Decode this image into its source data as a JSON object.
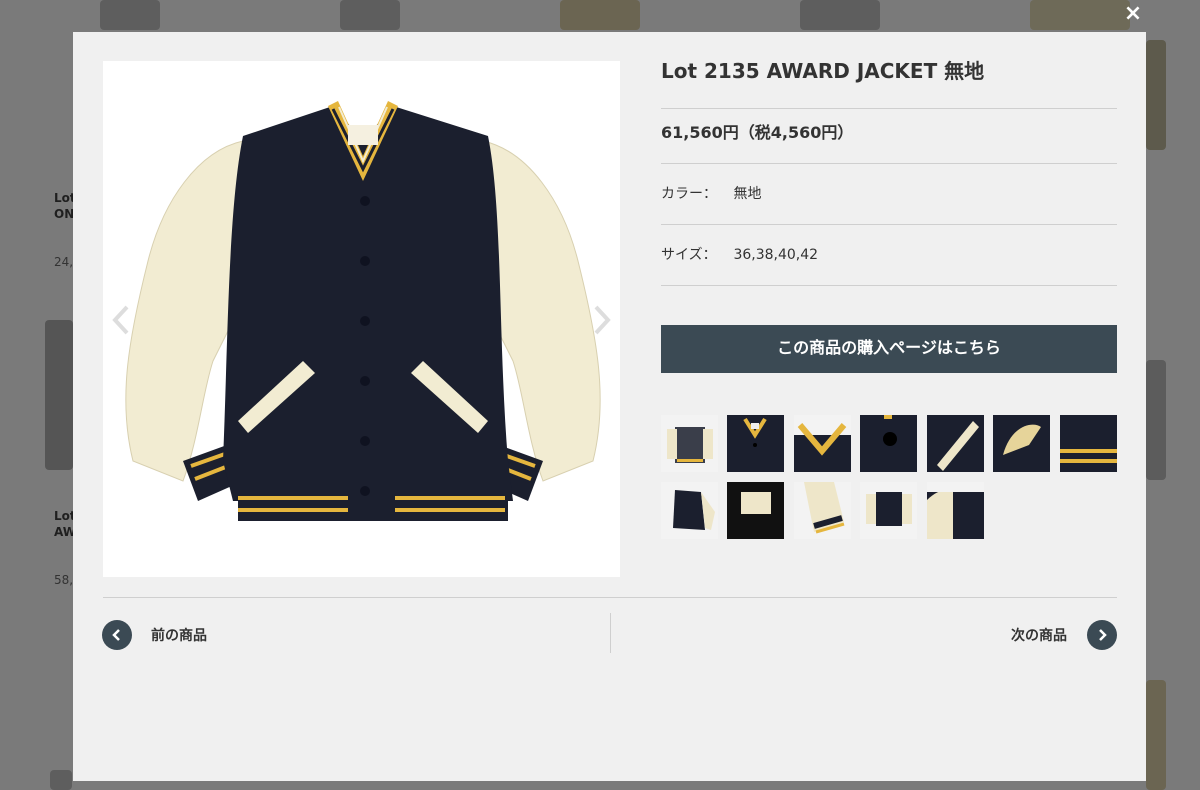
{
  "background": {
    "items": [
      {
        "line1": "Lot",
        "line2": "ON",
        "price": "24,"
      },
      {
        "line1": "Lot",
        "line2": "AW",
        "price": "58,"
      }
    ]
  },
  "modal": {
    "close_label": "×",
    "product": {
      "title": "Lot 2135 AWARD JACKET 無地",
      "price": "61,560円（税4,560円）",
      "color_label": "カラー：",
      "color_value": "無地",
      "size_label": "サイズ：",
      "size_value": "36,38,40,42"
    },
    "buy_button": "この商品の購入ページはこちら",
    "thumbnails": [
      "front-jacket-thumb",
      "collar-thumb",
      "collar-closeup-thumb",
      "button-thumb",
      "pocket-thumb",
      "pocket-open-thumb",
      "cuff-thumb",
      "side-jacket-thumb",
      "label-thumb",
      "sleeve-thumb",
      "back-jacket-thumb",
      "shoulder-thumb"
    ],
    "prev_label": "前の商品",
    "next_label": "次の商品"
  },
  "colors": {
    "accent": "#3b4a54",
    "navy": "#1b1f2e",
    "cream": "#f2ecd2",
    "gold": "#e5b63e"
  }
}
